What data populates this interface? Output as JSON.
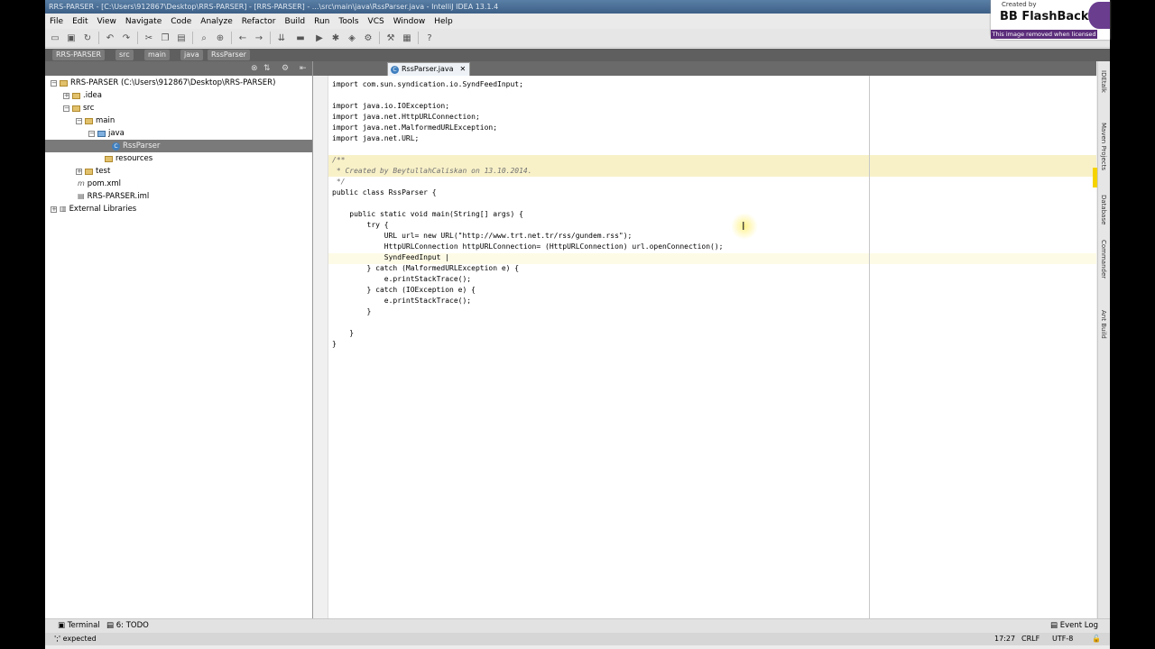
{
  "window_title": "RRS-PARSER - [C:\\Users\\912867\\Desktop\\RRS-PARSER] - [RRS-PARSER] - ...\\src\\main\\java\\RssParser.java - IntelliJ IDEA 13.1.4",
  "menu": [
    "File",
    "Edit",
    "View",
    "Navigate",
    "Code",
    "Analyze",
    "Refactor",
    "Build",
    "Run",
    "Tools",
    "VCS",
    "Window",
    "Help"
  ],
  "breadcrumbs": [
    "RRS-PARSER",
    "src",
    "main",
    "java",
    "RssParser"
  ],
  "editor_tab": "RssParser.java",
  "project_tree": [
    {
      "label": "RRS-PARSER (C:\\Users\\912867\\Desktop\\RRS-PARSER)",
      "depth": 0
    },
    {
      "label": ".idea",
      "depth": 1
    },
    {
      "label": "src",
      "depth": 1
    },
    {
      "label": "main",
      "depth": 2
    },
    {
      "label": "java",
      "depth": 3
    },
    {
      "label": "RssParser",
      "depth": 4
    },
    {
      "label": "resources",
      "depth": 4
    },
    {
      "label": "test",
      "depth": 2
    },
    {
      "label": "pom.xml",
      "depth": 1
    },
    {
      "label": "RRS-PARSER.iml",
      "depth": 1
    },
    {
      "label": "External Libraries",
      "depth": 0
    }
  ],
  "code_lines": [
    "import com.sun.syndication.io.SyndFeedInput;",
    "",
    "import java.io.IOException;",
    "import java.net.HttpURLConnection;",
    "import java.net.MalformedURLException;",
    "import java.net.URL;",
    "",
    "/**",
    " * Created by BeytullahCaliskan on 13.10.2014.",
    " */",
    "public class RssParser {",
    "",
    "    public static void main(String[] args) {",
    "        try {",
    "            URL url= new URL(\"http://www.trt.net.tr/rss/gundem.rss\");",
    "            HttpURLConnection httpURLConnection= (HttpURLConnection) url.openConnection();",
    "            SyndFeedInput |",
    "        } catch (MalformedURLException e) {",
    "            e.printStackTrace();",
    "        } catch (IOException e) {",
    "            e.printStackTrace();",
    "        }",
    "",
    "    }",
    "}"
  ],
  "right_tools": [
    "IDEtalk",
    "Maven Projects",
    "Database",
    "Commander",
    "Ant Build"
  ],
  "bottom_tools": {
    "terminal": "Terminal",
    "todo": "6: TODO",
    "event_log": "Event Log"
  },
  "status": {
    "message": "';' expected",
    "position": "17:27",
    "line_sep": "CRLF",
    "encoding": "UTF-8"
  },
  "watermark": {
    "created_by": "Created by",
    "brand": "BB FlashBack",
    "note": "This image removed when licensed"
  }
}
